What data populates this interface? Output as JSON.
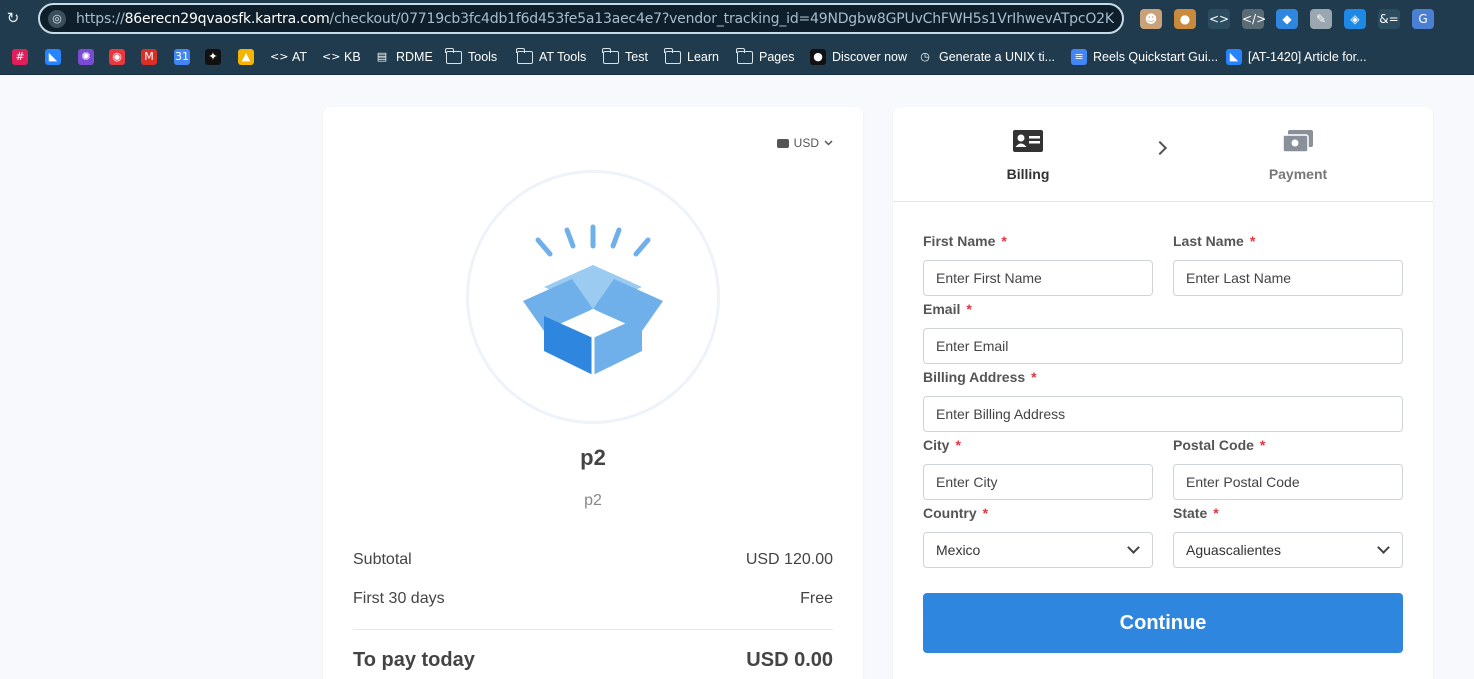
{
  "browser": {
    "url_scheme": "https://",
    "url_host": "86erecn29qvaosfk.kartra.com",
    "url_path": "/checkout/07719cb3fc4db1f6d453fe5a13aec4e7?vendor_tracking_id=49NDgbw8GPUvChFWH5s1VrIhwevATpcO2K",
    "extensions": [
      {
        "icon": "owl-extension-icon",
        "glyph": "☻",
        "color": "#c9a27a"
      },
      {
        "icon": "cookie-extension-icon",
        "glyph": "●",
        "color": "#c98a3c"
      },
      {
        "icon": "code-brackets-extension-icon",
        "glyph": "<>",
        "color": "#2c4d60"
      },
      {
        "icon": "html-tag-extension-icon",
        "glyph": "</>",
        "color": "#5a6b75"
      },
      {
        "icon": "tag-extension-icon",
        "glyph": "◆",
        "color": "#2e86de"
      },
      {
        "icon": "wrench-extension-icon",
        "glyph": "✎",
        "color": "#9aa7b0"
      },
      {
        "icon": "price-tag-extension-icon",
        "glyph": "◈",
        "color": "#1e88e5"
      },
      {
        "icon": "entity-extension-icon",
        "glyph": "&=",
        "color": "#2c4d60"
      },
      {
        "icon": "translate-extension-icon",
        "glyph": "G",
        "color": "#4a7fd4"
      }
    ],
    "bookmarks": [
      {
        "label": "",
        "icon": "slack-icon",
        "glyph": "#",
        "color": "#e01e5a"
      },
      {
        "label": "",
        "icon": "jira-icon",
        "glyph": "◣",
        "color": "#2684ff"
      },
      {
        "label": "",
        "icon": "purple-gear-icon",
        "glyph": "✺",
        "color": "#7b4bd6"
      },
      {
        "label": "",
        "icon": "red-app-icon",
        "glyph": "◉",
        "color": "#e8383d"
      },
      {
        "label": "",
        "icon": "gmail-icon",
        "glyph": "M",
        "color": "#d93025"
      },
      {
        "label": "",
        "icon": "calendar-icon",
        "glyph": "31",
        "color": "#4285f4"
      },
      {
        "label": "",
        "icon": "openai-icon",
        "glyph": "✦",
        "color": "#111111"
      },
      {
        "label": "",
        "icon": "drive-icon",
        "glyph": "▲",
        "color": "#f4b400"
      },
      {
        "label": "AT",
        "icon": "code-icon",
        "glyph": "<>",
        "color": "#1f3b4d"
      },
      {
        "label": "KB",
        "icon": "code-icon",
        "glyph": "<>",
        "color": "#1f3b4d"
      },
      {
        "label": "RDME",
        "icon": "book-icon",
        "glyph": "▤",
        "color": "#1f3b4d"
      },
      {
        "label": "Tools",
        "icon": "folder-icon"
      },
      {
        "label": "AT Tools",
        "icon": "folder-icon"
      },
      {
        "label": "Test",
        "icon": "folder-icon"
      },
      {
        "label": "Learn",
        "icon": "folder-icon"
      },
      {
        "label": "Pages",
        "icon": "folder-icon"
      },
      {
        "label": "Discover now",
        "icon": "discover-icon",
        "glyph": "●",
        "color": "#111111"
      },
      {
        "label": "Generate a UNIX ti...",
        "icon": "clock-icon",
        "glyph": "◷",
        "color": "#1f3b4d"
      },
      {
        "label": "Reels Quickstart Gui...",
        "icon": "doc-icon",
        "glyph": "≡",
        "color": "#4285f4"
      },
      {
        "label": "[AT-1420] Article for...",
        "icon": "jira-icon",
        "glyph": "◣",
        "color": "#2684ff"
      }
    ]
  },
  "summary": {
    "currency": "USD",
    "product_name": "p2",
    "product_desc": "p2",
    "subtotal_label": "Subtotal",
    "subtotal_value": "USD 120.00",
    "trial_label": "First 30 days",
    "trial_value": "Free",
    "total_label": "To pay today",
    "total_value": "USD 0.00"
  },
  "steps": {
    "billing": "Billing",
    "payment": "Payment"
  },
  "form": {
    "first_name_label": "First Name",
    "first_name_placeholder": "Enter First Name",
    "last_name_label": "Last Name",
    "last_name_placeholder": "Enter Last Name",
    "email_label": "Email",
    "email_placeholder": "Enter Email",
    "address_label": "Billing Address",
    "address_placeholder": "Enter Billing Address",
    "city_label": "City",
    "city_placeholder": "Enter City",
    "postal_label": "Postal Code",
    "postal_placeholder": "Enter Postal Code",
    "country_label": "Country",
    "country_value": "Mexico",
    "state_label": "State",
    "state_value": "Aguascalientes",
    "required_mark": "*",
    "continue_label": "Continue"
  },
  "colors": {
    "accent": "#2e86de",
    "required": "#e0363f",
    "browser_bar": "#1f3b4d",
    "box_light": "#6fb0eb",
    "box_dark": "#2e86de"
  }
}
